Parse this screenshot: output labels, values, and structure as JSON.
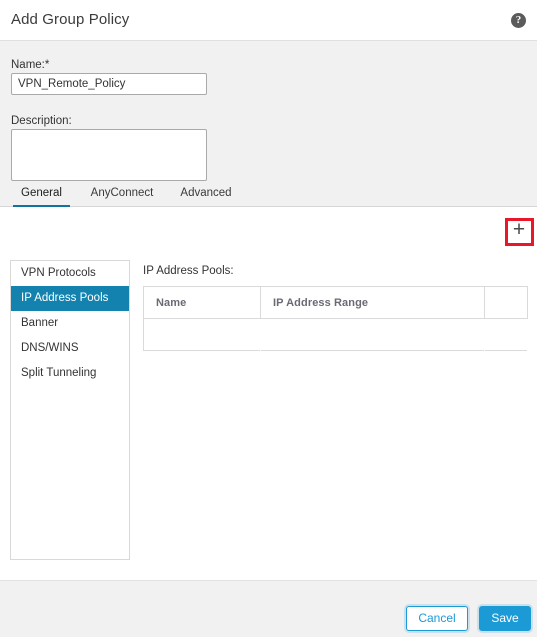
{
  "header": {
    "title": "Add Group Policy",
    "help_icon": "help-circle-icon",
    "help_glyph": "?"
  },
  "form": {
    "name_label": "Name:*",
    "name_value": "VPN_Remote_Policy",
    "name_placeholder": "",
    "description_label": "Description:",
    "description_value": "",
    "description_placeholder": ""
  },
  "tabs": [
    {
      "label": "General",
      "active": true
    },
    {
      "label": "AnyConnect",
      "active": false
    },
    {
      "label": "Advanced",
      "active": false
    }
  ],
  "sidebar": {
    "items": [
      {
        "label": "VPN Protocols",
        "selected": false
      },
      {
        "label": "IP Address Pools",
        "selected": true
      },
      {
        "label": "Banner",
        "selected": false
      },
      {
        "label": "DNS/WINS",
        "selected": false
      },
      {
        "label": "Split Tunneling",
        "selected": false
      }
    ]
  },
  "content": {
    "pools_label": "IP Address Pools:",
    "add_button_glyph": "+",
    "add_button_icon": "plus-icon",
    "table": {
      "columns": [
        "Name",
        "IP Address Range",
        ""
      ],
      "rows": []
    }
  },
  "footer": {
    "cancel_label": "Cancel",
    "save_label": "Save"
  },
  "colors": {
    "accent_blue": "#1c9ad6",
    "tab_underline": "#11739e",
    "sidebar_selected": "#1482ae",
    "highlight_red": "#e8172a",
    "body_background": "#f1f1f1",
    "panel_background": "#ffffff"
  }
}
